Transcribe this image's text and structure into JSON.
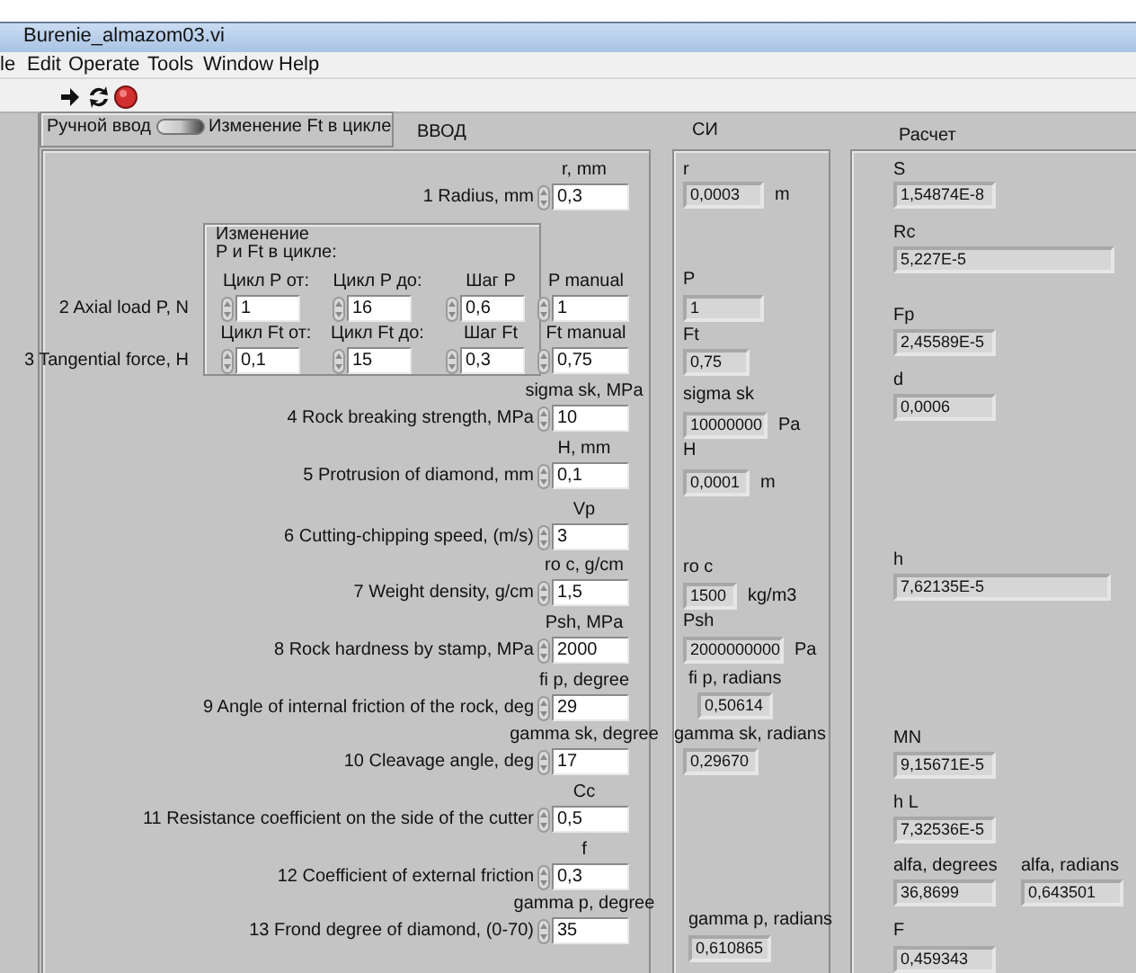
{
  "window": {
    "title": "Burenie_almazom03.vi"
  },
  "menu": [
    "le",
    "Edit",
    "Operate",
    "Tools",
    "Window",
    "Help"
  ],
  "mode_switch": {
    "left_label": "Ручной ввод",
    "right_label": "Изменение Ft в цикле",
    "on": false
  },
  "input_panel": {
    "title": "ВВОД",
    "rows": [
      {
        "label": "1 Radius, mm",
        "caption": "r, mm",
        "value": "0,3"
      },
      {
        "label": "4 Rock breaking strength, MPa",
        "caption": "sigma sk, MPa",
        "value": "10"
      },
      {
        "label": "5  Protrusion of diamond, mm",
        "caption": "H, mm",
        "value": "0,1"
      },
      {
        "label": "6 Cutting-chipping speed, (m/s)",
        "caption": "Vp",
        "value": "3"
      },
      {
        "label": "7 Weight density, g/cm",
        "caption": "ro c, g/cm",
        "value": "1,5"
      },
      {
        "label": "8 Rock hardness by stamp, MPa",
        "caption": "Psh, MPa",
        "value": "2000"
      },
      {
        "label": "9 Angle of internal friction of the rock, deg",
        "caption": "fi p, degree",
        "value": "29"
      },
      {
        "label": "10 Cleavage angle, deg",
        "caption": "gamma sk, degree",
        "value": "17"
      },
      {
        "label": "11 Resistance coefficient on the side of the cutter",
        "caption": "Cc",
        "value": "0,5"
      },
      {
        "label": "12 Coefficient of external friction",
        "caption": "f",
        "value": "0,3"
      },
      {
        "label": "13 Frond degree of diamond, (0-70)",
        "caption": "gamma p, degree",
        "value": "35"
      }
    ]
  },
  "cycle_group": {
    "title": "Изменение\nP и Ft в цикле:",
    "rows": [
      {
        "label": "2 Axial load P, N",
        "fields": [
          {
            "caption": "Цикл P от:",
            "value": "1"
          },
          {
            "caption": "Цикл P до:",
            "value": "16"
          },
          {
            "caption": "Шаг P",
            "value": "0,6"
          }
        ],
        "manual": {
          "caption": "P manual",
          "value": "1"
        }
      },
      {
        "label": "3 Tangential force, H",
        "fields": [
          {
            "caption": "Цикл Ft от:",
            "value": "0,1"
          },
          {
            "caption": "Цикл Ft до:",
            "value": "15"
          },
          {
            "caption": "Шаг Ft",
            "value": "0,3"
          }
        ],
        "manual": {
          "caption": "Ft manual",
          "value": "0,75"
        }
      }
    ]
  },
  "si_panel": {
    "title": "СИ",
    "items": [
      {
        "caption": "r",
        "value": "0,0003",
        "unit": "m"
      },
      {
        "caption": "P",
        "value": "1"
      },
      {
        "caption": "Ft",
        "value": "0,75"
      },
      {
        "caption": "sigma sk",
        "value": "10000000",
        "unit": "Pa"
      },
      {
        "caption": "H",
        "value": "0,0001",
        "unit": "m"
      },
      {
        "caption": "ro c",
        "value": "1500",
        "unit": "kg/m3"
      },
      {
        "caption": "Psh",
        "value": "2000000000",
        "unit": "Pa"
      },
      {
        "caption": "fi p, radians",
        "value": "0,50614"
      },
      {
        "caption": "gamma sk, radians",
        "value": "0,29670"
      },
      {
        "caption": "gamma p, radians",
        "value": "0,610865"
      }
    ]
  },
  "calc_panel": {
    "title": "Расчет",
    "items": [
      {
        "caption": "S",
        "value": "1,54874E-8"
      },
      {
        "caption": "Rc",
        "value": "5,227E-5"
      },
      {
        "caption": "Fp",
        "value": "2,45589E-5"
      },
      {
        "caption": "d",
        "value": "0,0006"
      },
      {
        "caption": "h",
        "value": "7,62135E-5"
      },
      {
        "caption": "MN",
        "value": "9,15671E-5"
      },
      {
        "caption": "h L",
        "value": "7,32536E-5"
      },
      {
        "caption": "alfa, degrees",
        "value": "36,8699"
      },
      {
        "caption": "alfa, radians",
        "value": "0,643501"
      },
      {
        "caption": "F",
        "value": "0,459343"
      }
    ]
  }
}
